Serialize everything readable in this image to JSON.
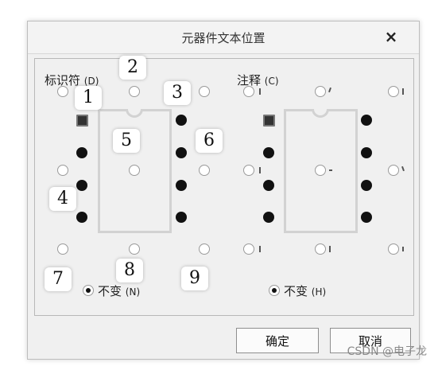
{
  "dialog": {
    "title": "元器件文本位置",
    "close_glyph": "×"
  },
  "designator_group": {
    "label": "标识符",
    "hotkey": "(D)",
    "unchanged_label": "不变",
    "unchanged_hotkey": "(N)",
    "unchanged_selected": true
  },
  "comment_group": {
    "label": "注释",
    "hotkey": "(C)",
    "unchanged_label": "不变",
    "unchanged_hotkey": "(H)",
    "unchanged_selected": true
  },
  "callouts": [
    "1",
    "2",
    "3",
    "4",
    "5",
    "6",
    "7",
    "8",
    "9"
  ],
  "buttons": {
    "ok": "确定",
    "cancel": "取消"
  },
  "watermark": "CSDN @电子龙",
  "icons": {
    "close": "close-icon",
    "chip": "ic-chip-outline-icon"
  }
}
